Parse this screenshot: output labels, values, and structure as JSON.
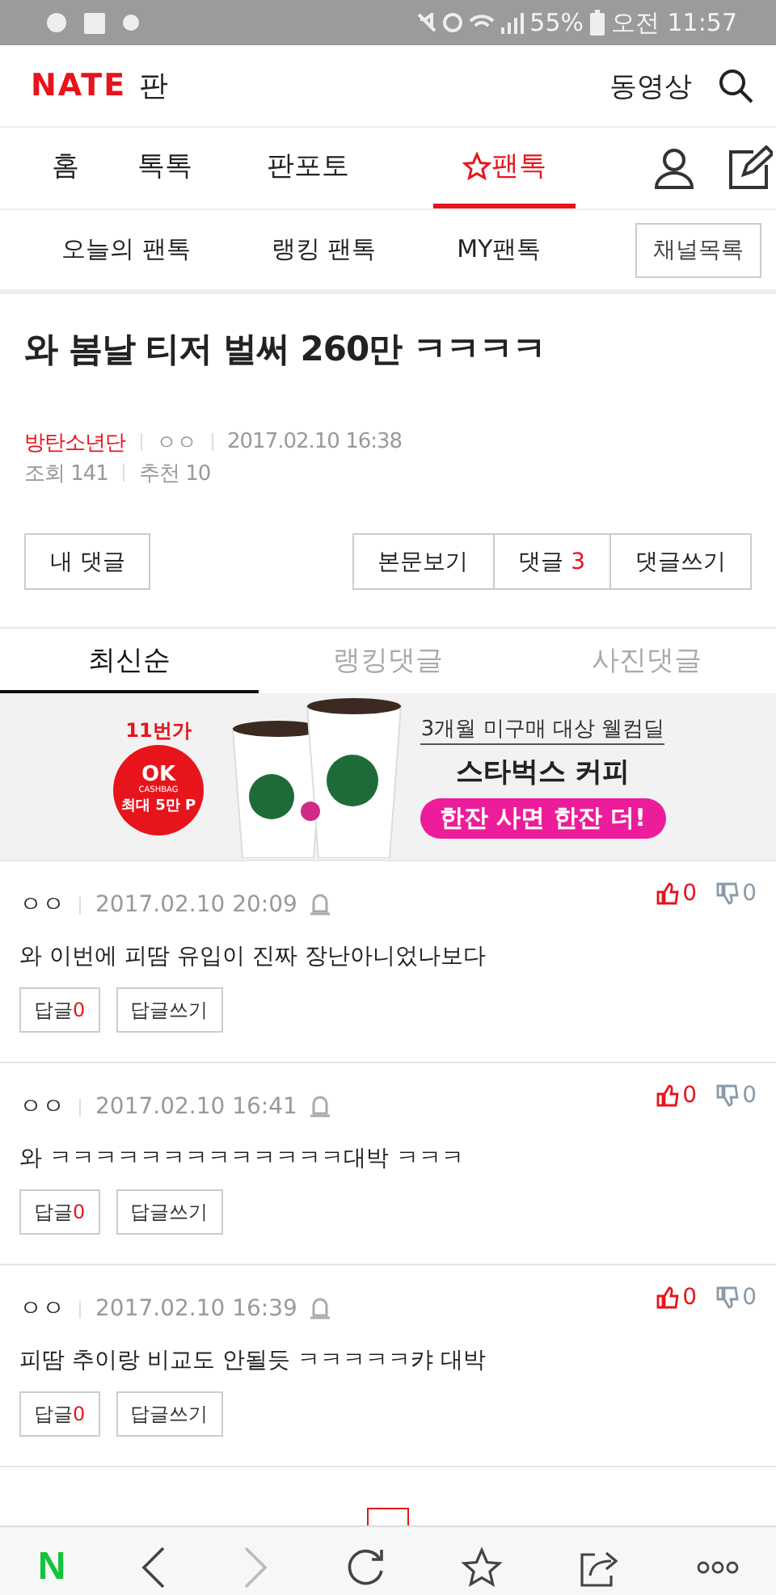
{
  "status_bar": {
    "battery": "55%",
    "time": "오전 11:57"
  },
  "header": {
    "logo": "NATE",
    "logo_suffix": "판",
    "video_link": "동영상"
  },
  "nav_tabs": [
    {
      "label": "홈",
      "selected": false,
      "star": false
    },
    {
      "label": "톡톡",
      "selected": false,
      "star": false
    },
    {
      "label": "판포토",
      "selected": false,
      "star": false
    },
    {
      "label": "팬톡",
      "selected": true,
      "star": true
    }
  ],
  "sub_nav": {
    "items": [
      "오늘의 팬톡",
      "랭킹 팬톡",
      "MY팬톡"
    ],
    "channel_button": "채널목록"
  },
  "post": {
    "title": "와 봄날 티저 벌써 260만 ㅋㅋㅋㅋ",
    "channel": "방탄소년단",
    "author": "ㅇㅇ",
    "date": "2017.02.10 16:38",
    "views": "조회 141",
    "recommends": "추천 10"
  },
  "actions": {
    "my_comments": "내 댓글",
    "view_post": "본문보기",
    "comments_label": "댓글",
    "comments_count": "3",
    "write_comment": "댓글쓰기"
  },
  "comment_tabs": [
    {
      "label": "최신순",
      "selected": true
    },
    {
      "label": "랭킹댓글",
      "selected": false
    },
    {
      "label": "사진댓글",
      "selected": false
    }
  ],
  "banner": {
    "store": "11번가",
    "cashbag": "OK",
    "cashbag_sub": "CASHBAG",
    "cashbag_points": "최대 5만 P",
    "headline": "3개월 미구매 대상 웰컴딜",
    "product": "스타벅스 커피",
    "offer": "한잔 사면 한잔 더!"
  },
  "comments": [
    {
      "author": "ㅇㅇ",
      "date": "2017.02.10 20:09",
      "likes": "0",
      "dislikes": "0",
      "text": "와 이번에 피땀 유입이 진짜 장난아니었나보다",
      "replies_label": "답글",
      "replies": "0",
      "reply_button": "답글쓰기"
    },
    {
      "author": "ㅇㅇ",
      "date": "2017.02.10 16:41",
      "likes": "0",
      "dislikes": "0",
      "text": "와 ㅋㅋㅋㅋㅋㅋㅋㅋㅋㅋㅋㅋㅋ대박 ㅋㅋㅋ",
      "replies_label": "답글",
      "replies": "0",
      "reply_button": "답글쓰기"
    },
    {
      "author": "ㅇㅇ",
      "date": "2017.02.10 16:39",
      "likes": "0",
      "dislikes": "0",
      "text": "피땀 추이랑 비교도 안될듯 ㅋㅋㅋㅋㅋ캬 대박",
      "replies_label": "답글",
      "replies": "0",
      "reply_button": "답글쓰기"
    }
  ],
  "bottom_bar": {
    "home_logo": "N",
    "forward_disabled": true
  }
}
